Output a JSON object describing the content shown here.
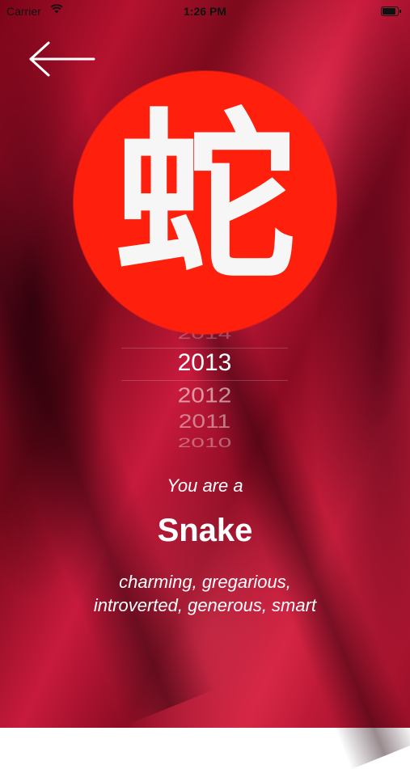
{
  "status_bar": {
    "carrier": "Carrier",
    "time": "1:26 PM",
    "battery_level": 0.9
  },
  "navigation": {
    "back_icon": "arrow-left-icon"
  },
  "badge": {
    "glyph": "蛇",
    "color": "#fe1f0c"
  },
  "year_picker": {
    "years": [
      "2014",
      "2013",
      "2012",
      "2011",
      "2010"
    ],
    "selected": "2013"
  },
  "result": {
    "intro": "You are a",
    "sign": "Snake",
    "traits_line1": "charming, gregarious,",
    "traits_line2": "introverted, generous, smart"
  }
}
